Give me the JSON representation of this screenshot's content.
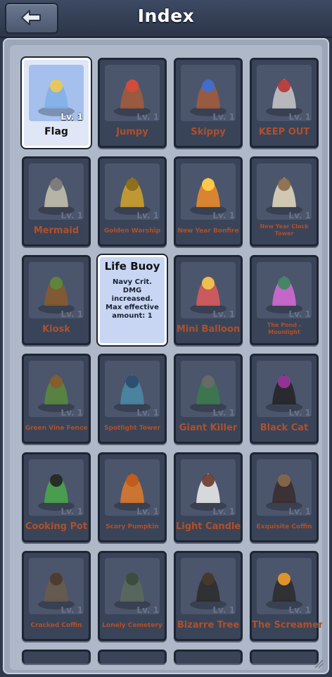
{
  "header": {
    "title": "Index",
    "back_icon": "back-arrow-icon"
  },
  "items": [
    {
      "name": "Flag",
      "level": "Lv. 1",
      "state": "selected"
    },
    {
      "name": "Jumpy",
      "level": "Lv. 1"
    },
    {
      "name": "Skippy",
      "level": "Lv. 1"
    },
    {
      "name": "KEEP OUT",
      "level": "Lv. 1"
    },
    {
      "name": "Mermaid",
      "level": "Lv. 1"
    },
    {
      "name": "Golden Warship",
      "level": "Lv. 1"
    },
    {
      "name": "New Year Bonfire",
      "level": "Lv. 1"
    },
    {
      "name": "New Year Clock Tower",
      "level": "Lv. 1"
    },
    {
      "name": "Kiosk",
      "level": "Lv. 1"
    },
    {
      "name": "Life Buoy",
      "level": "",
      "state": "info",
      "description": "Navy Crit. DMG increased. Max effective amount: 1"
    },
    {
      "name": "Mini Balloon",
      "level": "Lv. 1"
    },
    {
      "name": "The Pond - Moonlight",
      "level": "Lv. 1"
    },
    {
      "name": "Green Vine Fence",
      "level": "Lv. 1"
    },
    {
      "name": "Spotlight Tower",
      "level": "Lv. 1"
    },
    {
      "name": "Giant Killer",
      "level": "Lv. 1"
    },
    {
      "name": "Black Cat",
      "level": "Lv. 1"
    },
    {
      "name": "Cooking Pot",
      "level": "Lv. 1"
    },
    {
      "name": "Scary Pumpkin",
      "level": "Lv. 1"
    },
    {
      "name": "Light Candle",
      "level": "Lv. 1"
    },
    {
      "name": "Exquisite Coffin",
      "level": "Lv. 1"
    },
    {
      "name": "Cracked Coffin",
      "level": "Lv. 1"
    },
    {
      "name": "Lonely Cemetery",
      "level": "Lv. 1"
    },
    {
      "name": "Bizarre Tree",
      "level": "Lv. 1"
    },
    {
      "name": "The Screamer",
      "level": "Lv. 1"
    }
  ],
  "colors": {
    "name_text": "#b0502a",
    "card_bg": "#3a4458",
    "panel_bg": "#aeb8c8",
    "selected_bg": "#dfe7f6"
  }
}
